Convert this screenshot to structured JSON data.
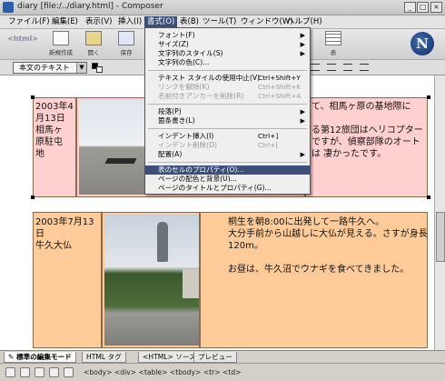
{
  "window": {
    "title": "diary [file:/../diary.html] - Composer"
  },
  "menubar": {
    "items": [
      {
        "label": "ファイル(F)"
      },
      {
        "label": "編集(E)"
      },
      {
        "label": "表示(V)"
      },
      {
        "label": "挿入(I)"
      },
      {
        "label": "書式(O)"
      },
      {
        "label": "表(B)"
      },
      {
        "label": "ツール(T)"
      },
      {
        "label": "ウィンドウ(W)"
      },
      {
        "label": "ヘルプ(H)"
      }
    ]
  },
  "toolbar": {
    "buttons": [
      {
        "label": "新規作成"
      },
      {
        "label": "開く"
      },
      {
        "label": "保存"
      },
      {
        "label": ""
      },
      {
        "label": "表"
      }
    ]
  },
  "formatbar": {
    "style_value": "本文のテキスト"
  },
  "format_menu": {
    "items": [
      {
        "label": "フォント(F)",
        "shortcut": "",
        "submenu": true,
        "disabled": false
      },
      {
        "label": "サイズ(Z)",
        "shortcut": "",
        "submenu": true,
        "disabled": false
      },
      {
        "label": "文字列のスタイル(S)",
        "shortcut": "",
        "submenu": true,
        "disabled": false
      },
      {
        "label": "文字列の色(C)...",
        "shortcut": "",
        "submenu": false,
        "disabled": false
      },
      {
        "label": "テキスト スタイルの使用中止(V)",
        "shortcut": "Ctrl+Shift+Y",
        "submenu": false,
        "disabled": false
      },
      {
        "label": "リンクを解除(K)",
        "shortcut": "Ctrl+Shift+K",
        "submenu": false,
        "disabled": true
      },
      {
        "label": "名前付きアンカーを削除(R)",
        "shortcut": "Ctrl+Shift+A",
        "submenu": false,
        "disabled": true
      },
      {
        "label": "段落(P)",
        "shortcut": "",
        "submenu": true,
        "disabled": false
      },
      {
        "label": "箇条書き(L)",
        "shortcut": "",
        "submenu": true,
        "disabled": false
      },
      {
        "label": "インデント挿入(I)",
        "shortcut": "Ctrl+]",
        "submenu": false,
        "disabled": false
      },
      {
        "label": "インデント削除(D)",
        "shortcut": "Ctrl+[",
        "submenu": false,
        "disabled": true
      },
      {
        "label": "配置(A)",
        "shortcut": "",
        "submenu": true,
        "disabled": false
      },
      {
        "label": "表のセルのプロパティ(O)...",
        "shortcut": "",
        "submenu": false,
        "disabled": false,
        "highlighted": true
      },
      {
        "label": "ページの配色と背景(U)...",
        "shortcut": "",
        "submenu": false,
        "disabled": false
      },
      {
        "label": "ページのタイトルとプロパティ(G)...",
        "shortcut": "",
        "submenu": false,
        "disabled": false
      }
    ]
  },
  "document": {
    "entry1": {
      "date": "2003年4\n月13日\n相馬ヶ\n原駐屯\n地",
      "text": "て、相馬ヶ原の基地際に\n\nる第12旅団はヘリコプター\nですが、偵察部隊のオート\nは 凄かったです。"
    },
    "entry2": {
      "date": "2003年7月13\n日\n牛久大仏",
      "text": "桐生を朝8:00に出発して一路牛久へ。\n大分手前から山越しに大仏が見える。さすが身長\n120m。\n\nお昼は、牛久沼でウナギを食べてきました。"
    }
  },
  "tabs": [
    {
      "label": "標準の編集モード"
    },
    {
      "label": "HTML タグ"
    },
    {
      "label": "<HTML> ソース"
    },
    {
      "label": "プレビュー"
    }
  ],
  "statusbar": {
    "tagpath": "<body> <div> <table> <tbody> <tr> <td>"
  },
  "colors": {
    "menu_highlight": "#3c4f7a",
    "cell_pink": "#ffd0d0",
    "cell_orange": "#ffcc99"
  }
}
